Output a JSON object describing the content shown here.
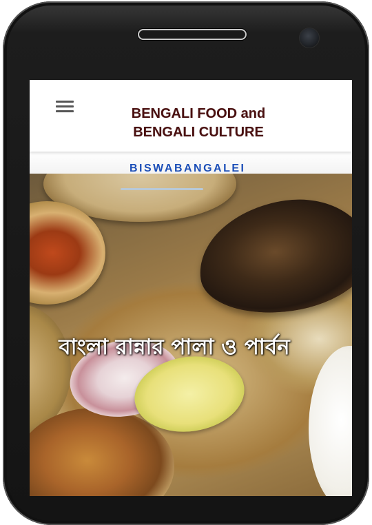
{
  "header": {
    "menu_icon": "hamburger-menu-icon",
    "title_line1": "BENGALI FOOD and",
    "title_line2": "BENGALI CULTURE"
  },
  "brand": {
    "label": "BISWABANGALEI"
  },
  "hero": {
    "caption": "বাংলা রান্নার পালা ও পার্বন"
  },
  "colors": {
    "title": "#4a1010",
    "brand": "#1c4fb8",
    "phone_body": "#141414"
  }
}
